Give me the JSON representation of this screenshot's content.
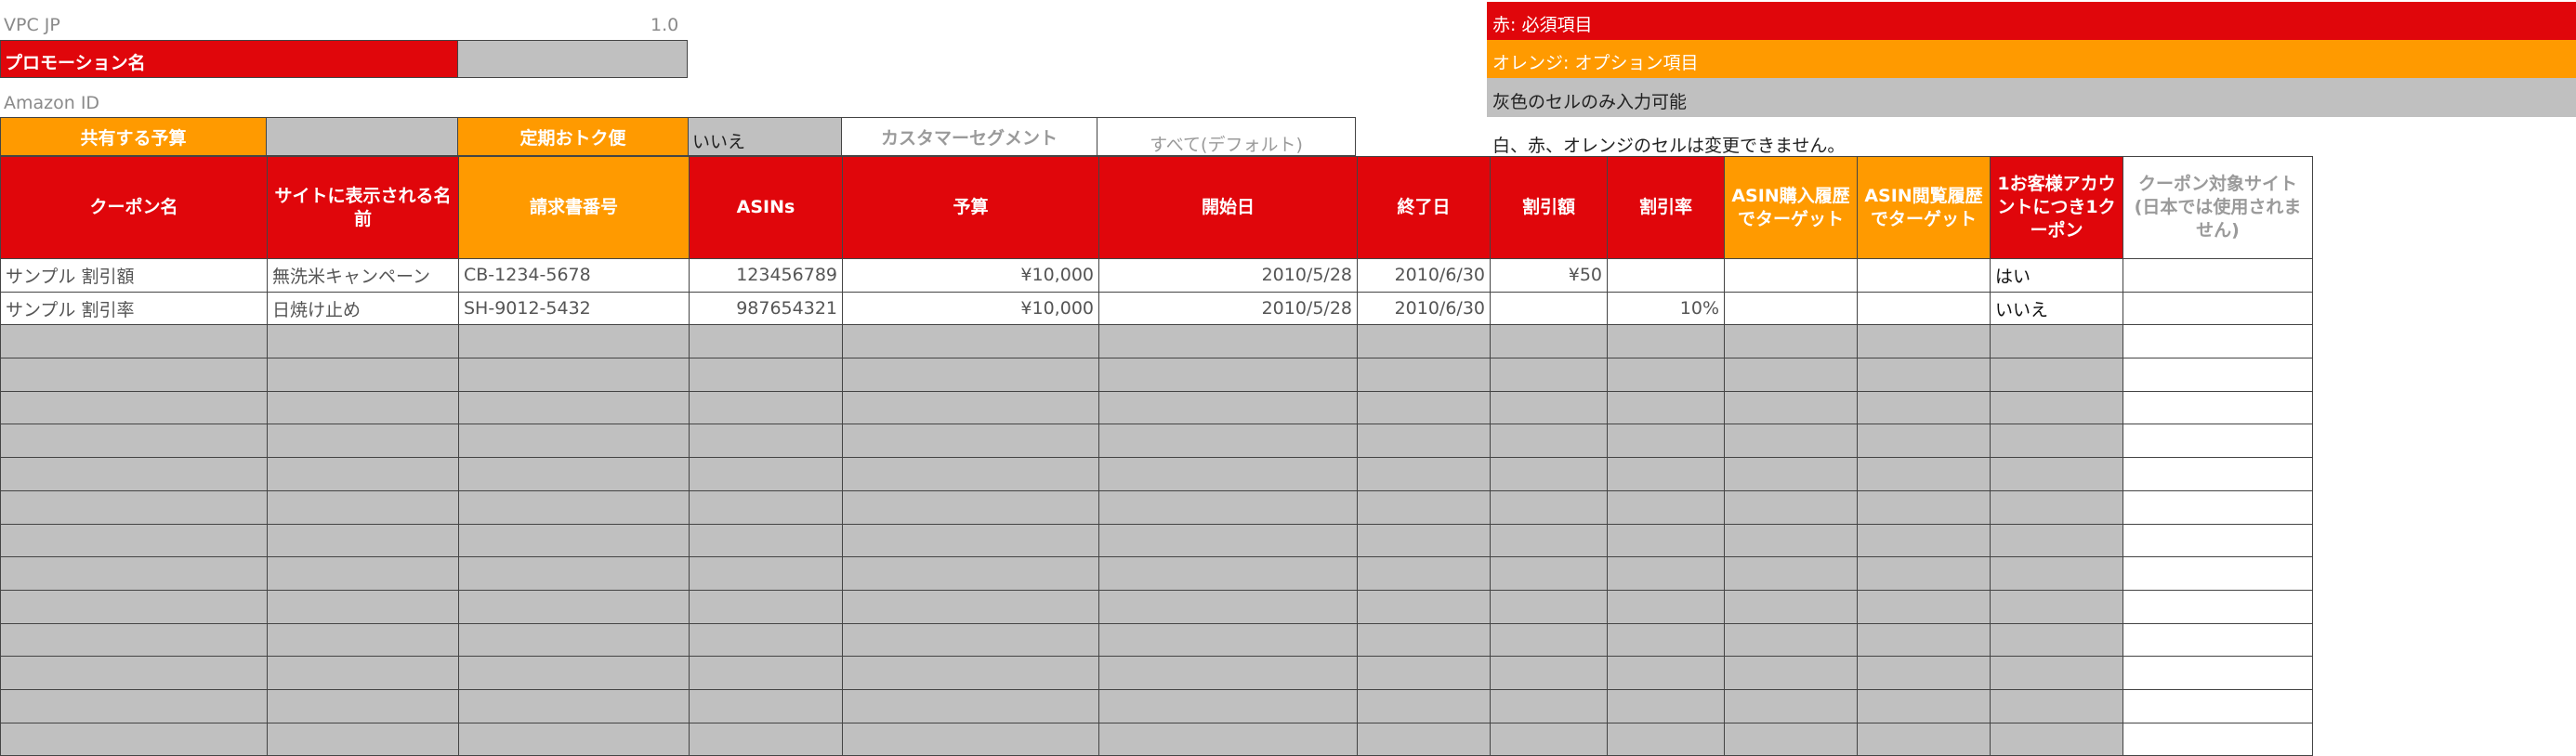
{
  "top": {
    "vpc_label": "VPC JP",
    "version": "1.0",
    "promotion_name_label": "プロモーション名",
    "amazon_id_label": "Amazon ID",
    "shared_budget_label": "共有する予算",
    "subscribe_save_label": "定期おトク便",
    "subscribe_save_value": "いいえ",
    "customer_segment_label": "カスタマーセグメント",
    "customer_segment_value": "すべて(デフォルト)"
  },
  "legend": {
    "red": "赤: 必須項目",
    "orange": "オレンジ: オプション項目",
    "gray": "灰色のセルのみ入力可能",
    "note": "白、赤、オレンジのセルは変更できません。"
  },
  "colors": {
    "red": "#e0060b",
    "orange": "#ff9a00",
    "gray": "#c0c0c0"
  },
  "table": {
    "columns": [
      {
        "label": "クーポン名",
        "color": "red"
      },
      {
        "label": "サイトに表示される名前",
        "color": "red"
      },
      {
        "label": "請求書番号",
        "color": "orange"
      },
      {
        "label": "ASINs",
        "color": "red"
      },
      {
        "label": "予算",
        "color": "red"
      },
      {
        "label": "開始日",
        "color": "red"
      },
      {
        "label": "終了日",
        "color": "red"
      },
      {
        "label": "割引額",
        "color": "red"
      },
      {
        "label": "割引率",
        "color": "red"
      },
      {
        "label": "ASIN購入履歴でターゲット",
        "color": "orange"
      },
      {
        "label": "ASIN閲覧履歴でターゲット",
        "color": "orange"
      },
      {
        "label": "1お客様アカウントにつき1クーポン",
        "color": "red"
      },
      {
        "label": "クーポン対象サイト(日本では使用されません)",
        "color": "white"
      }
    ],
    "rows": [
      [
        "サンプル 割引額",
        "無洗米キャンペーン",
        "CB-1234-5678",
        "123456789",
        "¥10,000",
        "2010/5/28",
        "2010/6/30",
        "¥50",
        "",
        "",
        "",
        "はい",
        ""
      ],
      [
        "サンプル 割引率",
        "日焼け止め",
        "SH-9012-5432",
        "987654321",
        "¥10,000",
        "2010/5/28",
        "2010/6/30",
        "",
        "10%",
        "",
        "",
        "いいえ",
        ""
      ]
    ],
    "empty_rows": 13
  }
}
